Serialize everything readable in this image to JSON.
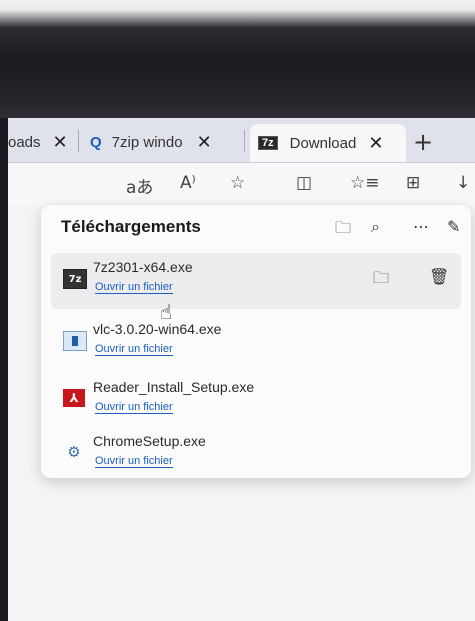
{
  "tabs": [
    {
      "label": "oads",
      "close": "✕"
    },
    {
      "label": "7zip windo",
      "close": "✕"
    },
    {
      "label": "Download",
      "close": "✕",
      "favicon": "7z"
    }
  ],
  "new_tab_label": "+",
  "toolbar": {
    "read_aloud": "aあ",
    "immersive": "A⁾",
    "favorite": "☆",
    "split": "◫",
    "favorites_list": "☆≡",
    "collections": "⊞",
    "downloads": "↓"
  },
  "downloads_panel": {
    "title": "Téléchargements",
    "items": [
      {
        "file": "7z2301-x64.exe",
        "action": "Ouvrir un fichier",
        "icon": "7z"
      },
      {
        "file": "vlc-3.0.20-win64.exe",
        "action": "Ouvrir un fichier",
        "icon": "vlc-installer"
      },
      {
        "file": "Reader_Install_Setup.exe",
        "action": "Ouvrir un fichier",
        "icon": "acrobat-reader"
      },
      {
        "file": "ChromeSetup.exe",
        "action": "Ouvrir un fichier",
        "icon": "chrome-setup"
      }
    ]
  },
  "colors": {
    "link": "#1a5fc4",
    "panel_bg": "#fbfbfc",
    "tabbar": "#dfe2ea"
  }
}
